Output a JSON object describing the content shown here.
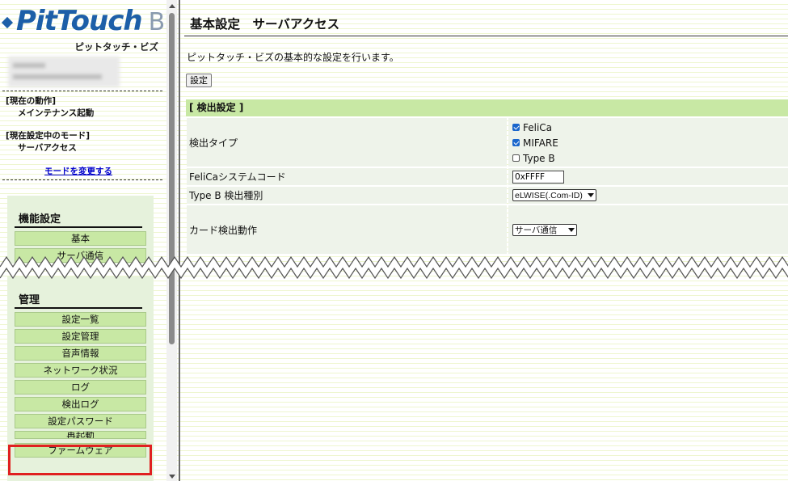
{
  "sidebar": {
    "logo_text": "PitTouch",
    "logo_biz": "Biz",
    "logo_sub": "ピットタッチ・ビズ",
    "current_action_label": "[現在の動作]",
    "current_action_value": "メインテナンス起動",
    "current_mode_label": "[現在設定中のモード]",
    "current_mode_value": "サーバアクセス",
    "change_mode_link": "モードを変更する",
    "function_settings": {
      "title": "機能設定",
      "items": [
        "基本",
        "サーバ通信"
      ]
    },
    "management": {
      "title": "管理",
      "items": [
        "設定一覧",
        "設定管理",
        "音声情報",
        "ネットワーク状況",
        "ログ",
        "検出ログ",
        "設定パスワード",
        "再起動",
        "ファームウェア"
      ]
    }
  },
  "main": {
    "title": "基本設定　サーバアクセス",
    "description": "ピットタッチ・ビズの基本的な設定を行います。",
    "set_button": "設定",
    "section_header": "[ 検出設定 ]",
    "rows": {
      "detect_type": {
        "label": "検出タイプ",
        "options": [
          {
            "label": "FeliCa",
            "checked": true
          },
          {
            "label": "MIFARE",
            "checked": true
          },
          {
            "label": "Type B",
            "checked": false
          }
        ]
      },
      "felica_code": {
        "label": "FeliCaシステムコード",
        "value": "0xFFFF"
      },
      "typeb_kind": {
        "label": "Type B 検出種別",
        "selected": "eLWISE(.Com-ID)"
      },
      "card_action": {
        "label": "カード検出動作",
        "selected": "サーバ通信"
      }
    }
  },
  "colors": {
    "menu_button": "#c8e8a4",
    "panel_bg": "#e6f2dc",
    "highlight": "#e02020",
    "logo_blue": "#1d5fa8",
    "link": "#0000cc"
  }
}
